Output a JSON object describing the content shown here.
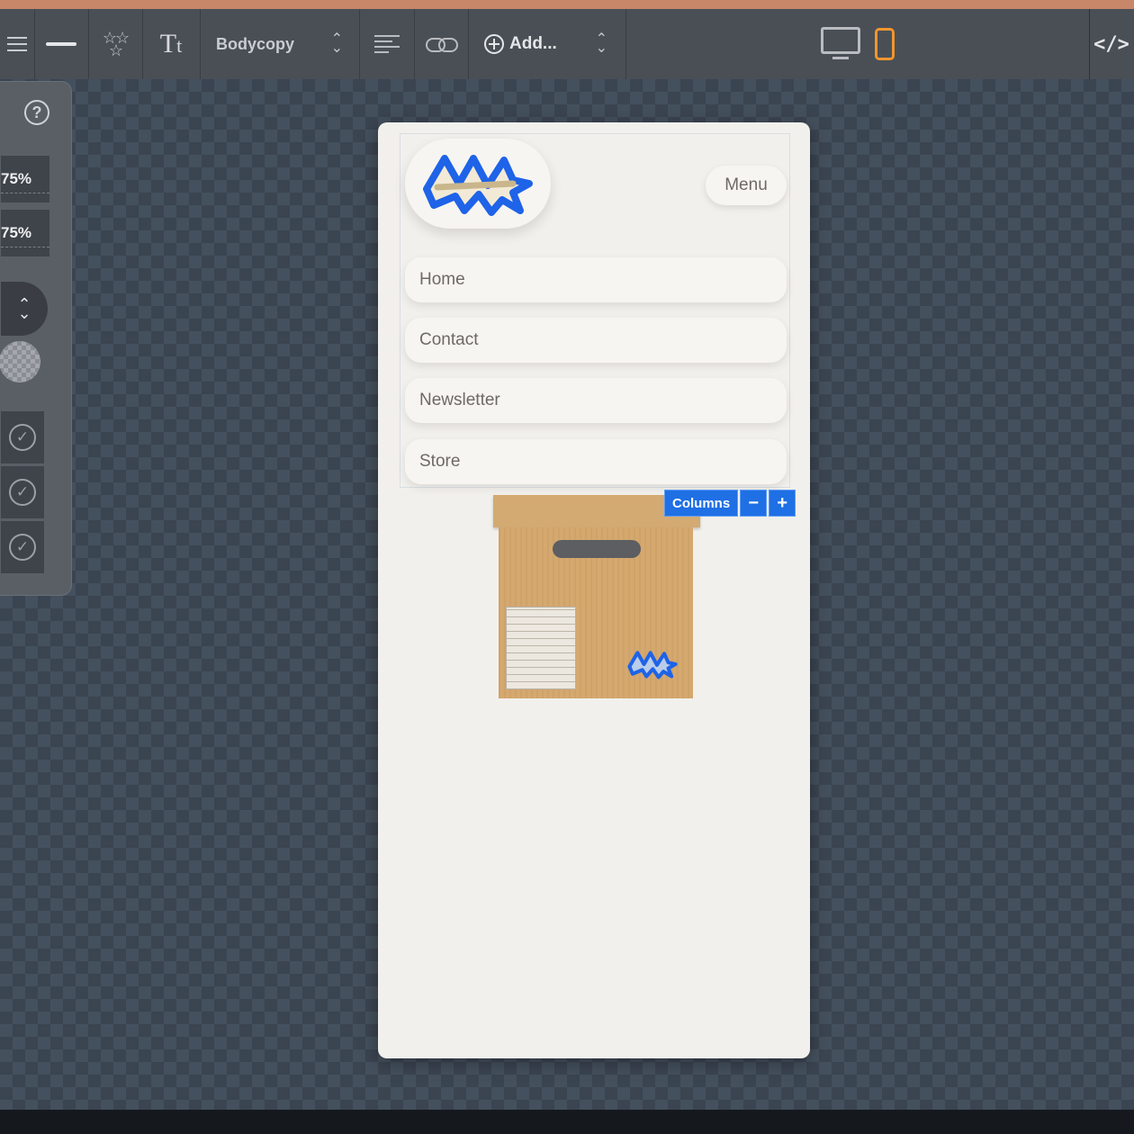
{
  "toolbar": {
    "font_style": "Bodycopy",
    "add_label": "Add..."
  },
  "inspector": {
    "help_glyph": "?",
    "value_1": "75%",
    "value_2": "75%"
  },
  "preview": {
    "menu_label": "Menu",
    "nav_items": [
      "Home",
      "Contact",
      "Newsletter",
      "Store"
    ],
    "columns_label": "Columns",
    "columns_minus": "−",
    "columns_plus": "+"
  },
  "icons": [
    "hamburger-icon",
    "line-icon",
    "stars-icon",
    "text-style-icon",
    "align-icon",
    "link-icon",
    "add-circle-icon",
    "desktop-icon",
    "phone-icon",
    "code-icon"
  ],
  "colors": {
    "accent_blue": "#1f6fe5",
    "phone_active": "#f0962e",
    "logo_blue": "#1e63e8"
  }
}
